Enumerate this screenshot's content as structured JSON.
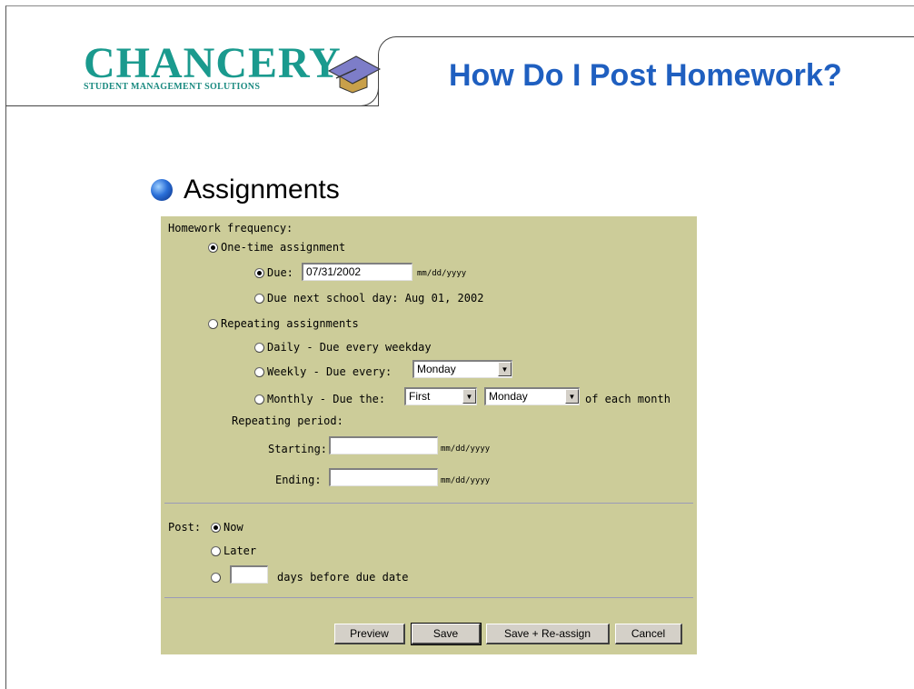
{
  "header": {
    "logo_word": "CHANCERY",
    "logo_tagline": "STUDENT MANAGEMENT SOLUTIONS",
    "title": "How Do I Post Homework?"
  },
  "section": {
    "title": "Assignments"
  },
  "form": {
    "frequency_label": "Homework frequency:",
    "one_time_label": "One-time assignment",
    "due_label": "Due:",
    "due_value": "07/31/2002",
    "date_hint": "mm/dd/yyyy",
    "due_next_label": "Due next school day:  Aug 01, 2002",
    "repeating_label": "Repeating assignments",
    "daily_label": "Daily - Due every weekday",
    "weekly_label": "Weekly - Due every:",
    "weekly_day": "Monday",
    "monthly_label": "Monthly - Due the:",
    "monthly_ordinal": "First",
    "monthly_day": "Monday",
    "monthly_suffix": "of each month",
    "repeating_period_label": "Repeating period:",
    "starting_label": "Starting:",
    "ending_label": "Ending:",
    "post_label": "Post:",
    "post_now_label": "Now",
    "post_later_label": "Later",
    "days_before_label": "days before due date",
    "buttons": {
      "preview": "Preview",
      "save": "Save",
      "save_reassign": "Save + Re-assign",
      "cancel": "Cancel"
    }
  },
  "colors": {
    "title": "#1f5fc0",
    "logo": "#1a9a8e",
    "panel": "#cccc99"
  }
}
